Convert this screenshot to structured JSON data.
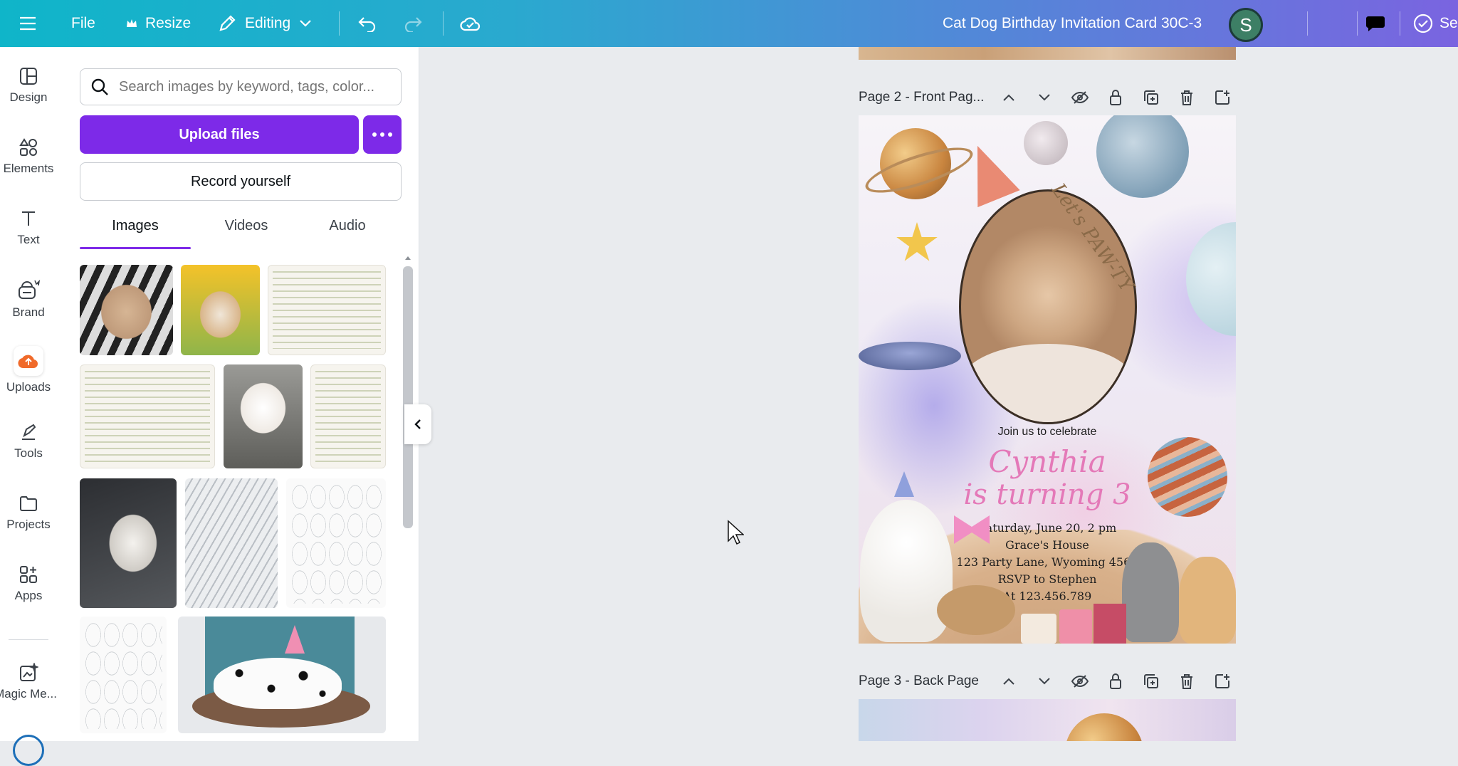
{
  "topbar": {
    "file_label": "File",
    "resize_label": "Resize",
    "editing_label": "Editing",
    "doc_title": "Cat Dog Birthday Invitation Card 30C-3",
    "avatar_letter": "S",
    "share_label": "Se"
  },
  "rail": {
    "items": [
      {
        "label": "Design",
        "icon": "design-icon"
      },
      {
        "label": "Elements",
        "icon": "elements-icon"
      },
      {
        "label": "Text",
        "icon": "text-icon"
      },
      {
        "label": "Brand",
        "icon": "brand-icon"
      },
      {
        "label": "Uploads",
        "icon": "uploads-icon"
      },
      {
        "label": "Tools",
        "icon": "tools-icon"
      },
      {
        "label": "Projects",
        "icon": "projects-icon"
      },
      {
        "label": "Apps",
        "icon": "apps-icon"
      },
      {
        "label": "Magic Me...",
        "icon": "magic-media-icon"
      }
    ]
  },
  "panel": {
    "search_placeholder": "Search images by keyword, tags, color...",
    "upload_label": "Upload files",
    "record_label": "Record yourself",
    "tabs": [
      "Images",
      "Videos",
      "Audio"
    ],
    "active_tab": "Images"
  },
  "canvas": {
    "page2_title": "Page 2 - Front Pag...",
    "page3_title": "Page 3 - Back Page",
    "card": {
      "lets": "Let's PAW-TY",
      "join": "Join us to celebrate",
      "name": "Cynthia",
      "turning": "is turning 3",
      "details": [
        "Saturday, June 20, 2 pm",
        "Grace's House",
        "123 Party Lane, Wyoming 4567",
        "RSVP to Stephen",
        "At 123.456.789"
      ]
    }
  },
  "colors": {
    "accent": "#7d2ae8",
    "topbar_start": "#0fb5c9",
    "topbar_end": "#7a64e0",
    "upload_orange": "#f06a2a"
  }
}
